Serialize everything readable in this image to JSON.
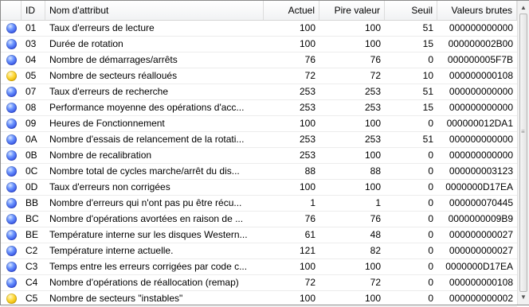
{
  "headers": {
    "id": "ID",
    "name": "Nom d'attribut",
    "current": "Actuel",
    "worst": "Pire valeur",
    "threshold": "Seuil",
    "raw": "Valeurs brutes"
  },
  "status_colors": {
    "ok": "#3a58e6",
    "warning": "#ffd93b"
  },
  "rows": [
    {
      "status": "ok",
      "id": "01",
      "name": "Taux d'erreurs de lecture",
      "current": "100",
      "worst": "100",
      "threshold": "51",
      "raw": "000000000000"
    },
    {
      "status": "ok",
      "id": "03",
      "name": "Durée de rotation",
      "current": "100",
      "worst": "100",
      "threshold": "15",
      "raw": "000000002B00"
    },
    {
      "status": "ok",
      "id": "04",
      "name": "Nombre de démarrages/arrêts",
      "current": "76",
      "worst": "76",
      "threshold": "0",
      "raw": "000000005F7B"
    },
    {
      "status": "warning",
      "id": "05",
      "name": "Nombre de secteurs réalloués",
      "current": "72",
      "worst": "72",
      "threshold": "10",
      "raw": "000000000108"
    },
    {
      "status": "ok",
      "id": "07",
      "name": "Taux d'erreurs de recherche",
      "current": "253",
      "worst": "253",
      "threshold": "51",
      "raw": "000000000000"
    },
    {
      "status": "ok",
      "id": "08",
      "name": "Performance moyenne des opérations d'acc...",
      "current": "253",
      "worst": "253",
      "threshold": "15",
      "raw": "000000000000"
    },
    {
      "status": "ok",
      "id": "09",
      "name": "Heures de Fonctionnement",
      "current": "100",
      "worst": "100",
      "threshold": "0",
      "raw": "000000012DA1"
    },
    {
      "status": "ok",
      "id": "0A",
      "name": "Nombre d'essais de relancement de la rotati...",
      "current": "253",
      "worst": "253",
      "threshold": "51",
      "raw": "000000000000"
    },
    {
      "status": "ok",
      "id": "0B",
      "name": "Nombre de recalibration",
      "current": "253",
      "worst": "100",
      "threshold": "0",
      "raw": "000000000000"
    },
    {
      "status": "ok",
      "id": "0C",
      "name": "Nombre total de cycles marche/arrêt du dis...",
      "current": "88",
      "worst": "88",
      "threshold": "0",
      "raw": "000000003123"
    },
    {
      "status": "ok",
      "id": "0D",
      "name": "Taux d'erreurs non corrigées",
      "current": "100",
      "worst": "100",
      "threshold": "0",
      "raw": "0000000D17EA"
    },
    {
      "status": "ok",
      "id": "BB",
      "name": "Nombre d'erreurs qui n'ont pas pu être récu...",
      "current": "1",
      "worst": "1",
      "threshold": "0",
      "raw": "000000070445"
    },
    {
      "status": "ok",
      "id": "BC",
      "name": "Nombre d'opérations avortées en raison de ...",
      "current": "76",
      "worst": "76",
      "threshold": "0",
      "raw": "0000000009B9"
    },
    {
      "status": "ok",
      "id": "BE",
      "name": "Température interne sur les disques Western...",
      "current": "61",
      "worst": "48",
      "threshold": "0",
      "raw": "000000000027"
    },
    {
      "status": "ok",
      "id": "C2",
      "name": "Température interne actuelle.",
      "current": "121",
      "worst": "82",
      "threshold": "0",
      "raw": "000000000027"
    },
    {
      "status": "ok",
      "id": "C3",
      "name": "Temps entre les erreurs corrigées par code c...",
      "current": "100",
      "worst": "100",
      "threshold": "0",
      "raw": "0000000D17EA"
    },
    {
      "status": "ok",
      "id": "C4",
      "name": "Nombre d'opérations de réallocation (remap)",
      "current": "72",
      "worst": "72",
      "threshold": "0",
      "raw": "000000000108"
    },
    {
      "status": "warning",
      "id": "C5",
      "name": "Nombre de secteurs \"instables\"",
      "current": "100",
      "worst": "100",
      "threshold": "0",
      "raw": "000000000002"
    }
  ]
}
